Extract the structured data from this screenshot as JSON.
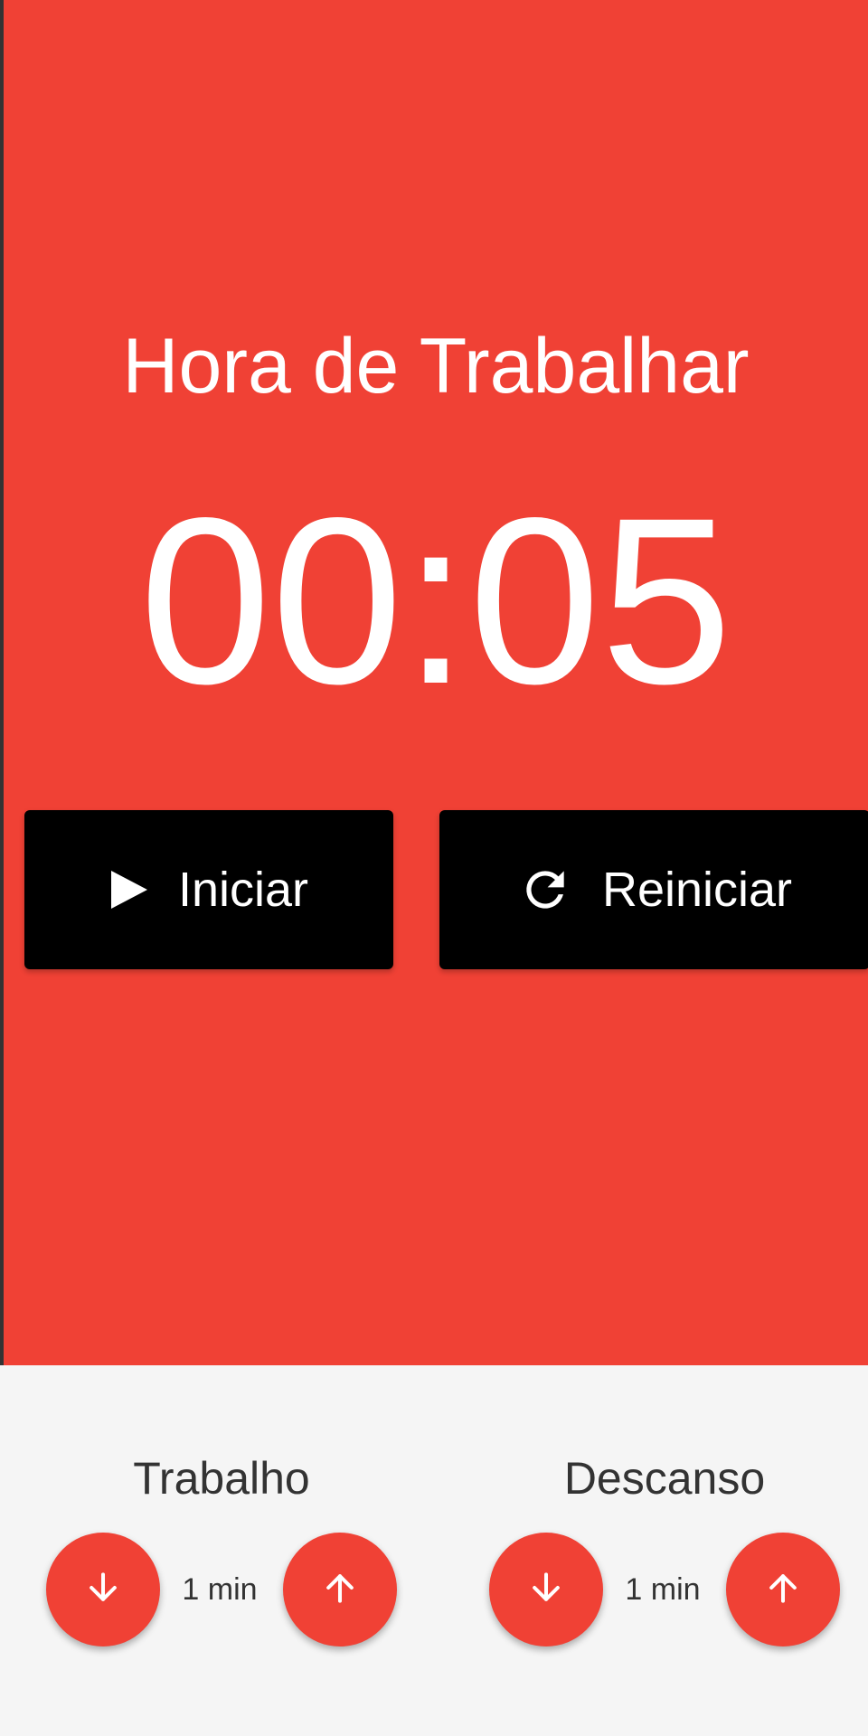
{
  "colors": {
    "accent": "#f04135",
    "button_bg": "#000000",
    "text_on_accent": "#ffffff",
    "settings_bg": "#f5f5f5"
  },
  "timer": {
    "mode_title": "Hora de Trabalhar",
    "time": "00:05"
  },
  "controls": {
    "start_label": "Iniciar",
    "start_icon": "play-icon",
    "reset_label": "Reiniciar",
    "reset_icon": "refresh-icon"
  },
  "settings": {
    "work": {
      "label": "Trabalho",
      "value": "1 min",
      "decrease_icon": "arrow-down-icon",
      "increase_icon": "arrow-up-icon"
    },
    "rest": {
      "label": "Descanso",
      "value": "1 min",
      "decrease_icon": "arrow-down-icon",
      "increase_icon": "arrow-up-icon"
    }
  }
}
